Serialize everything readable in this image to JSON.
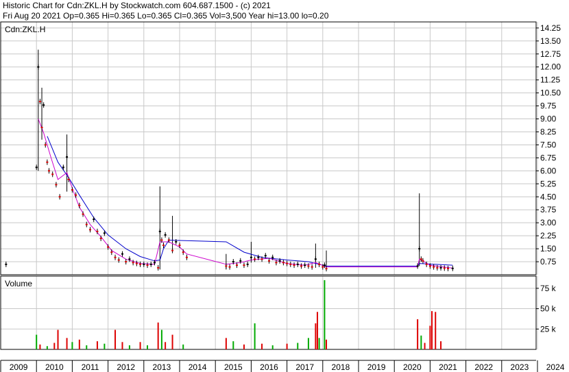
{
  "header": {
    "line1": "Historic Chart for Cdn:ZKL.H by Stockwatch.com 604.687.1500 - (c) 2021",
    "line2": "Fri Aug 20 2021   Op=0.365  Hi=0.365  Lo=0.365  Cl=0.365  Vol=3,500  Year hi=13.00  lo=0.20"
  },
  "chart_data": {
    "type": "line",
    "symbol": "Cdn:ZKL.H",
    "volume_label": "Volume",
    "x_ticks": [
      "2009",
      "2010",
      "2011",
      "2012",
      "2013",
      "2014",
      "2015",
      "2016",
      "2017",
      "2018",
      "2019",
      "2020",
      "2021",
      "2022",
      "2023",
      "2024"
    ],
    "price_ticks": [
      "14.25",
      "13.50",
      "12.75",
      "12.00",
      "11.25",
      "10.50",
      "9.75",
      "9.00",
      "8.25",
      "7.50",
      "6.75",
      "6.00",
      "5.25",
      "4.50",
      "3.75",
      "3.00",
      "2.25",
      "1.50",
      "0.75"
    ],
    "volume_ticks": [
      "75 k",
      "50 k",
      "25 k"
    ],
    "ylim": [
      0,
      14.6
    ],
    "volume_ylim": [
      0,
      90000
    ],
    "colors": {
      "up": "#00aa00",
      "down": "#dd0000",
      "price": "#000000",
      "ma_short": "#cc00cc",
      "ma_long": "#0000cc"
    },
    "price_series": [
      [
        2009.15,
        0.6
      ],
      [
        2010.0,
        6.2
      ],
      [
        2010.05,
        12.0
      ],
      [
        2010.1,
        10.0
      ],
      [
        2010.15,
        8.5
      ],
      [
        2010.2,
        9.8
      ],
      [
        2010.25,
        7.5
      ],
      [
        2010.3,
        6.5
      ],
      [
        2010.35,
        6.0
      ],
      [
        2010.45,
        5.8
      ],
      [
        2010.55,
        5.2
      ],
      [
        2010.65,
        4.5
      ],
      [
        2010.75,
        6.2
      ],
      [
        2010.85,
        6.8
      ],
      [
        2010.9,
        5.5
      ],
      [
        2011.0,
        4.9
      ],
      [
        2011.1,
        4.6
      ],
      [
        2011.2,
        4.0
      ],
      [
        2011.3,
        3.5
      ],
      [
        2011.4,
        2.9
      ],
      [
        2011.5,
        2.6
      ],
      [
        2011.6,
        3.2
      ],
      [
        2011.7,
        2.5
      ],
      [
        2011.8,
        2.1
      ],
      [
        2011.9,
        2.4
      ],
      [
        2012.0,
        1.6
      ],
      [
        2012.1,
        1.3
      ],
      [
        2012.2,
        1.0
      ],
      [
        2012.3,
        0.85
      ],
      [
        2012.4,
        1.2
      ],
      [
        2012.5,
        0.75
      ],
      [
        2012.6,
        0.9
      ],
      [
        2012.7,
        0.7
      ],
      [
        2012.8,
        0.65
      ],
      [
        2012.9,
        0.6
      ],
      [
        2013.0,
        0.6
      ],
      [
        2013.1,
        0.55
      ],
      [
        2013.2,
        0.6
      ],
      [
        2013.3,
        0.7
      ],
      [
        2013.4,
        0.4
      ],
      [
        2013.45,
        2.5
      ],
      [
        2013.5,
        2.0
      ],
      [
        2013.55,
        1.7
      ],
      [
        2013.6,
        2.3
      ],
      [
        2013.7,
        2.0
      ],
      [
        2013.8,
        1.4
      ],
      [
        2013.9,
        1.9
      ],
      [
        2014.0,
        1.7
      ],
      [
        2014.1,
        1.3
      ],
      [
        2014.2,
        1.0
      ],
      [
        2015.3,
        0.5
      ],
      [
        2015.4,
        0.45
      ],
      [
        2015.5,
        0.75
      ],
      [
        2015.6,
        0.55
      ],
      [
        2015.7,
        0.8
      ],
      [
        2015.8,
        0.55
      ],
      [
        2015.9,
        0.6
      ],
      [
        2016.0,
        1.0
      ],
      [
        2016.1,
        0.9
      ],
      [
        2016.2,
        1.0
      ],
      [
        2016.3,
        0.9
      ],
      [
        2016.4,
        1.1
      ],
      [
        2016.5,
        0.8
      ],
      [
        2016.6,
        1.0
      ],
      [
        2016.7,
        0.7
      ],
      [
        2016.8,
        0.8
      ],
      [
        2016.9,
        0.7
      ],
      [
        2017.0,
        0.65
      ],
      [
        2017.1,
        0.6
      ],
      [
        2017.2,
        0.55
      ],
      [
        2017.3,
        0.6
      ],
      [
        2017.4,
        0.5
      ],
      [
        2017.5,
        0.55
      ],
      [
        2017.6,
        0.5
      ],
      [
        2017.7,
        0.45
      ],
      [
        2017.8,
        0.9
      ],
      [
        2017.9,
        0.6
      ],
      [
        2018.0,
        0.45
      ],
      [
        2018.05,
        0.55
      ],
      [
        2018.1,
        0.35
      ],
      [
        2020.65,
        0.5
      ],
      [
        2020.7,
        1.5
      ],
      [
        2020.75,
        0.9
      ],
      [
        2020.8,
        0.8
      ],
      [
        2020.9,
        0.6
      ],
      [
        2021.0,
        0.5
      ],
      [
        2021.1,
        0.45
      ],
      [
        2021.2,
        0.4
      ],
      [
        2021.3,
        0.4
      ],
      [
        2021.4,
        0.38
      ],
      [
        2021.5,
        0.36
      ],
      [
        2021.63,
        0.365
      ]
    ],
    "spikes": [
      {
        "x": 2010.05,
        "high": 13.0,
        "low": 6.0
      },
      {
        "x": 2010.15,
        "high": 10.8,
        "low": 7.8
      },
      {
        "x": 2010.85,
        "high": 8.1,
        "low": 4.8
      },
      {
        "x": 2013.45,
        "high": 5.1,
        "low": 0.3
      },
      {
        "x": 2013.8,
        "high": 3.4,
        "low": 1.4
      },
      {
        "x": 2015.3,
        "high": 1.2,
        "low": 0.3
      },
      {
        "x": 2016.0,
        "high": 1.9,
        "low": 0.7
      },
      {
        "x": 2017.8,
        "high": 1.8,
        "low": 0.4
      },
      {
        "x": 2018.1,
        "high": 1.4,
        "low": 0.3
      },
      {
        "x": 2020.7,
        "high": 4.7,
        "low": 0.5
      }
    ],
    "ma_short": [
      [
        2010.05,
        9.0
      ],
      [
        2010.2,
        8.2
      ],
      [
        2010.4,
        6.8
      ],
      [
        2010.6,
        5.5
      ],
      [
        2010.85,
        5.9
      ],
      [
        2011.0,
        5.0
      ],
      [
        2011.2,
        3.9
      ],
      [
        2011.5,
        2.9
      ],
      [
        2011.8,
        2.2
      ],
      [
        2012.1,
        1.4
      ],
      [
        2012.5,
        0.9
      ],
      [
        2012.9,
        0.65
      ],
      [
        2013.3,
        0.6
      ],
      [
        2013.45,
        1.9
      ],
      [
        2013.7,
        1.9
      ],
      [
        2014.0,
        1.6
      ],
      [
        2014.2,
        1.2
      ],
      [
        2015.3,
        0.6
      ],
      [
        2015.7,
        0.7
      ],
      [
        2016.0,
        0.85
      ],
      [
        2016.5,
        0.95
      ],
      [
        2017.0,
        0.65
      ],
      [
        2017.5,
        0.55
      ],
      [
        2017.8,
        0.7
      ],
      [
        2018.1,
        0.45
      ],
      [
        2020.65,
        0.45
      ],
      [
        2020.7,
        0.9
      ],
      [
        2021.0,
        0.55
      ],
      [
        2021.63,
        0.38
      ]
    ],
    "ma_long": [
      [
        2010.3,
        8.0
      ],
      [
        2010.6,
        6.5
      ],
      [
        2010.9,
        5.6
      ],
      [
        2011.2,
        4.6
      ],
      [
        2011.6,
        3.3
      ],
      [
        2012.0,
        2.3
      ],
      [
        2012.5,
        1.5
      ],
      [
        2012.9,
        1.05
      ],
      [
        2013.3,
        0.8
      ],
      [
        2013.45,
        0.85
      ],
      [
        2013.55,
        1.5
      ],
      [
        2013.7,
        2.0
      ],
      [
        2015.3,
        1.9
      ],
      [
        2015.8,
        1.3
      ],
      [
        2016.3,
        1.0
      ],
      [
        2017.0,
        0.85
      ],
      [
        2017.6,
        0.75
      ],
      [
        2018.1,
        0.5
      ],
      [
        2020.65,
        0.5
      ],
      [
        2020.7,
        0.65
      ],
      [
        2021.63,
        0.55
      ]
    ],
    "volume_bars": [
      [
        2010.0,
        18000,
        "up"
      ],
      [
        2010.1,
        6000,
        "down"
      ],
      [
        2010.3,
        4000,
        "up"
      ],
      [
        2010.5,
        8000,
        "down"
      ],
      [
        2010.6,
        24000,
        "down"
      ],
      [
        2010.85,
        14000,
        "down"
      ],
      [
        2011.0,
        9000,
        "up"
      ],
      [
        2011.2,
        12000,
        "down"
      ],
      [
        2011.4,
        5000,
        "up"
      ],
      [
        2011.7,
        10000,
        "down"
      ],
      [
        2011.9,
        7000,
        "up"
      ],
      [
        2012.2,
        24000,
        "down"
      ],
      [
        2012.4,
        9000,
        "down"
      ],
      [
        2012.6,
        5000,
        "up"
      ],
      [
        2012.9,
        9000,
        "down"
      ],
      [
        2013.1,
        5000,
        "up"
      ],
      [
        2013.4,
        33000,
        "down"
      ],
      [
        2013.5,
        24000,
        "up"
      ],
      [
        2013.6,
        9000,
        "down"
      ],
      [
        2013.8,
        18000,
        "down"
      ],
      [
        2014.1,
        6000,
        "up"
      ],
      [
        2015.3,
        14000,
        "down"
      ],
      [
        2015.5,
        10000,
        "up"
      ],
      [
        2015.8,
        6000,
        "down"
      ],
      [
        2016.1,
        32000,
        "up"
      ],
      [
        2016.3,
        7000,
        "down"
      ],
      [
        2016.6,
        5000,
        "up"
      ],
      [
        2017.0,
        7000,
        "down"
      ],
      [
        2017.3,
        8000,
        "up"
      ],
      [
        2017.6,
        14000,
        "up"
      ],
      [
        2017.8,
        32000,
        "down"
      ],
      [
        2017.85,
        46000,
        "down"
      ],
      [
        2017.9,
        14000,
        "up"
      ],
      [
        2018.05,
        85000,
        "up"
      ],
      [
        2018.1,
        12000,
        "down"
      ],
      [
        2020.65,
        37000,
        "down"
      ],
      [
        2020.75,
        17000,
        "up"
      ],
      [
        2020.85,
        8000,
        "down"
      ],
      [
        2021.0,
        29000,
        "down"
      ],
      [
        2021.05,
        47000,
        "down"
      ],
      [
        2021.15,
        46000,
        "down"
      ],
      [
        2021.3,
        10000,
        "down"
      ]
    ]
  }
}
